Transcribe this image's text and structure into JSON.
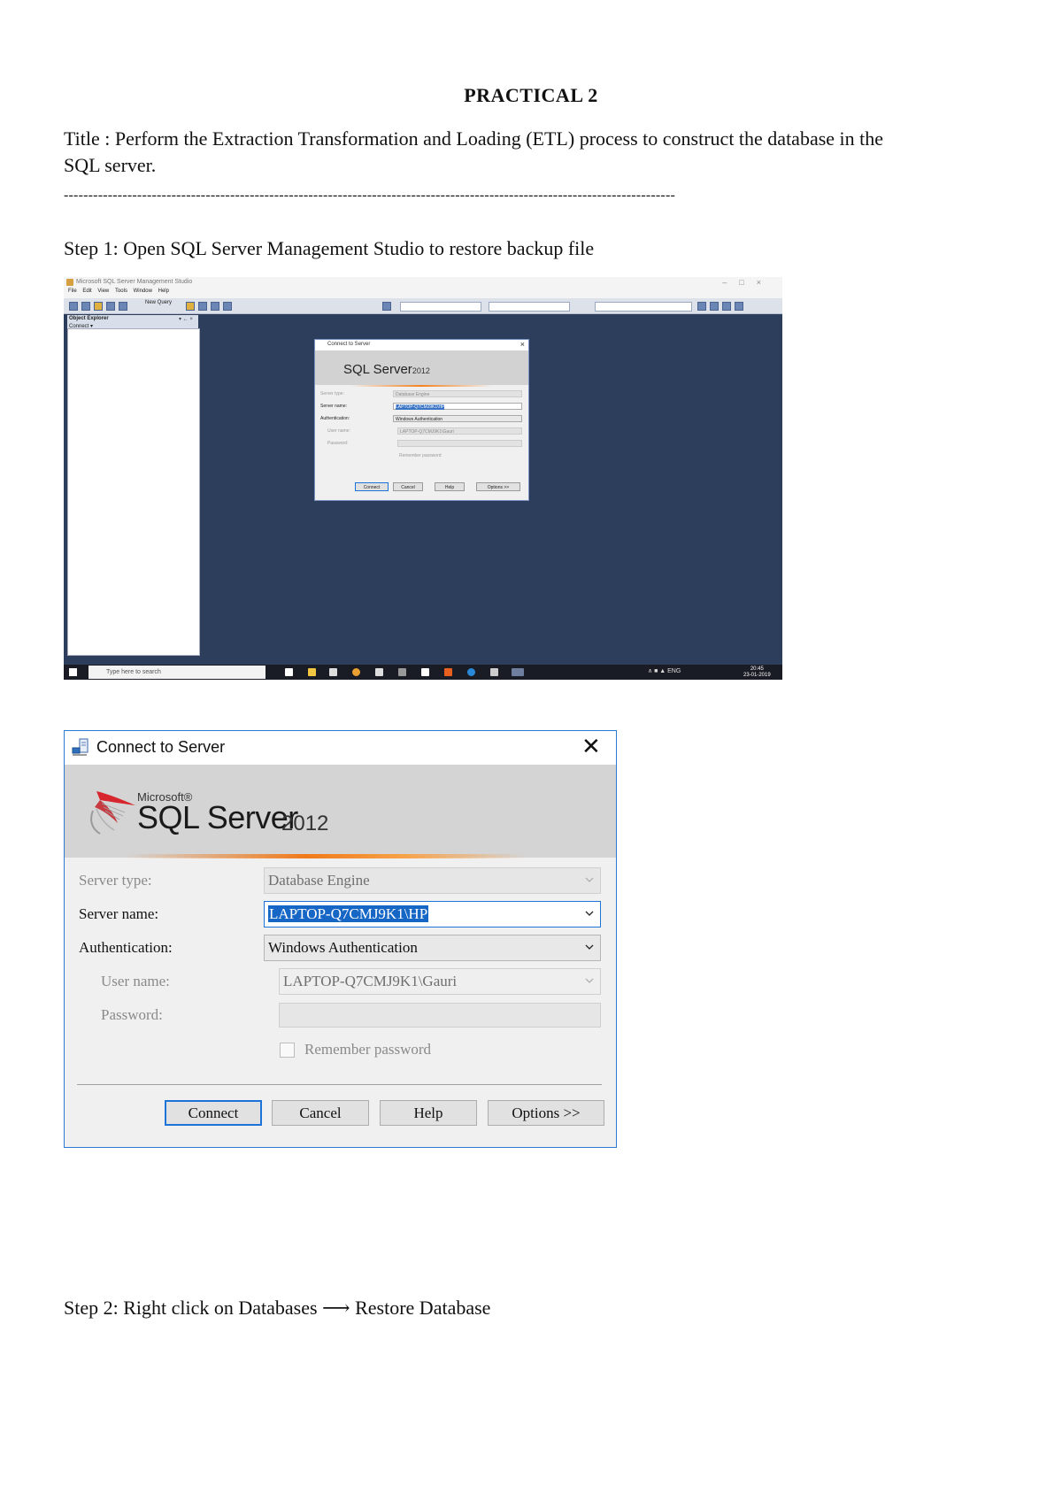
{
  "document": {
    "heading": "PRACTICAL 2",
    "title_line1": "Title : Perform the Extraction Transformation and Loading (ETL) process to construct the database in the",
    "title_line2": "SQL server.",
    "divider": "-----------------------------------------------------------------------------------------------------------------------------",
    "step1": "Step 1: Open SQL Server Management Studio to restore backup file",
    "step2": "Step 2: Right click on Databases ⟶ Restore Database"
  },
  "ssms_screenshot": {
    "window_title": "Microsoft SQL Server Management Studio",
    "menu": [
      "File",
      "Edit",
      "View",
      "Tools",
      "Window",
      "Help"
    ],
    "new_query": "New Query",
    "object_explorer": "Object Explorer",
    "object_explorer_pin": "▾ ← ×",
    "connect": "Connect ▾",
    "dialog_title": "Connect to Server",
    "taskbar_search": "Type here to search",
    "tray": "∧  ■  ▲  ENG",
    "clock_time": "20:45",
    "clock_date": "23-01-2019",
    "dialog": {
      "logo_sql": "SQL Server",
      "logo_year": "2012",
      "server_type_label": "Server type:",
      "server_type_value": "Database Engine",
      "server_name_label": "Server name:",
      "server_name_value": "LAPTOP-Q7CMJ9K1\\HP",
      "auth_label": "Authentication:",
      "auth_value": "Windows Authentication",
      "user_label": "User name:",
      "user_value": "LAPTOP-Q7CMJ9K1\\Gauri",
      "password_label": "Password:",
      "remember": "Remember password",
      "buttons": [
        "Connect",
        "Cancel",
        "Help",
        "Options >>"
      ]
    }
  },
  "connect_dialog": {
    "title": "Connect to Server",
    "close_glyph": "✕",
    "logo_microsoft": "Microsoft®",
    "logo_sql": "SQL Server",
    "logo_year": "2012",
    "server_type_label": "Server type:",
    "server_type_value": "Database Engine",
    "server_name_label": "Server name:",
    "server_name_value": "LAPTOP-Q7CMJ9K1\\HP",
    "authentication_label": "Authentication:",
    "authentication_value": "Windows Authentication",
    "user_name_label": "User name:",
    "user_name_value": "LAPTOP-Q7CMJ9K1\\Gauri",
    "password_label": "Password:",
    "password_value": "",
    "remember_password_label": "Remember password",
    "remember_password_checked": false,
    "connect_button": "Connect",
    "cancel_button": "Cancel",
    "help_button": "Help",
    "options_button": "Options >>",
    "accent_color": "#1d74d8",
    "orange_color": "#f07a1a"
  }
}
